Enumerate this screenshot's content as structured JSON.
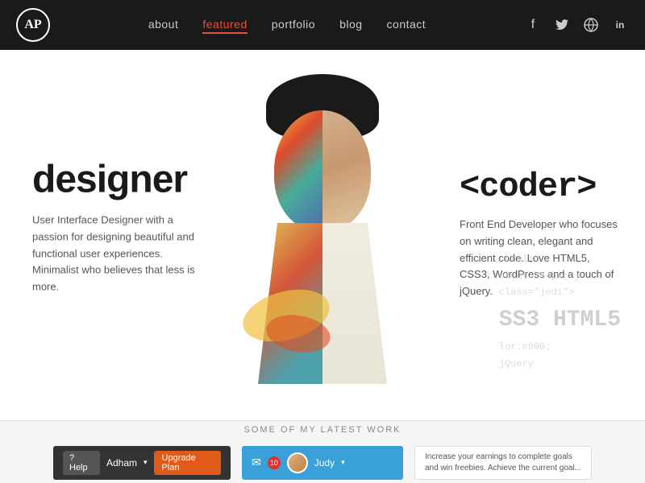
{
  "navbar": {
    "logo_text": "AP",
    "nav_items": [
      {
        "label": "about",
        "active": false
      },
      {
        "label": "featured",
        "active": true
      },
      {
        "label": "portfolio",
        "active": false
      },
      {
        "label": "blog",
        "active": false
      },
      {
        "label": "contact",
        "active": false
      }
    ],
    "social": [
      {
        "name": "facebook",
        "icon": "f"
      },
      {
        "name": "twitter",
        "icon": "🐦"
      },
      {
        "name": "dribbble",
        "icon": "⊕"
      },
      {
        "name": "linkedin",
        "icon": "in"
      }
    ]
  },
  "hero": {
    "designer_title": "designer",
    "designer_desc": "User Interface Designer with a passion for designing beautiful and functional user experiences. Minimalist who believes that less is more.",
    "coder_title": "<coder>",
    "coder_desc": "Front End Developer who focuses on writing clean, elegant and efficient code. Love HTML5, CSS3, WordPress and a touch of jQuery.",
    "code_lines": [
      "<html>",
      "eight:184px; }",
      "class=\"jedi\">",
      "SS3 HTML5",
      "lor:#000;",
      "jQuery"
    ]
  },
  "latest_work": {
    "title": "SOME OF MY LATEST WORK",
    "card1": {
      "help_label": "? Help",
      "name": "Adham",
      "upgrade_label": "Upgrade Plan"
    },
    "card2": {
      "mail_icon": "✉",
      "notif_count": "10",
      "name": "Judy"
    },
    "card3": {
      "text": "Increase your earnings to complete goals and win freebies. Achieve the current goal..."
    }
  }
}
